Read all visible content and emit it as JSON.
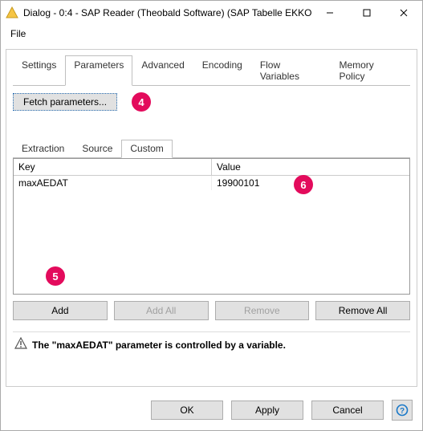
{
  "window": {
    "title": "Dialog - 0:4 - SAP Reader (Theobald Software) (SAP Tabelle EKKO)"
  },
  "menu": {
    "file": "File"
  },
  "tabs": {
    "settings": "Settings",
    "parameters": "Parameters",
    "advanced": "Advanced",
    "encoding": "Encoding",
    "flow_variables": "Flow Variables",
    "memory_policy": "Memory Policy"
  },
  "fetch": {
    "label": "Fetch parameters..."
  },
  "subtabs": {
    "extraction": "Extraction",
    "source": "Source",
    "custom": "Custom"
  },
  "table": {
    "headers": {
      "key": "Key",
      "value": "Value"
    },
    "rows": [
      {
        "key": "maxAEDAT",
        "value": "19900101"
      }
    ]
  },
  "param_buttons": {
    "add": "Add",
    "add_all": "Add All",
    "remove": "Remove",
    "remove_all": "Remove All"
  },
  "info": {
    "text": "The \"maxAEDAT\" parameter is controlled by a variable."
  },
  "dialog_buttons": {
    "ok": "OK",
    "apply": "Apply",
    "cancel": "Cancel"
  },
  "markers": {
    "m4": "4",
    "m5": "5",
    "m6": "6"
  }
}
